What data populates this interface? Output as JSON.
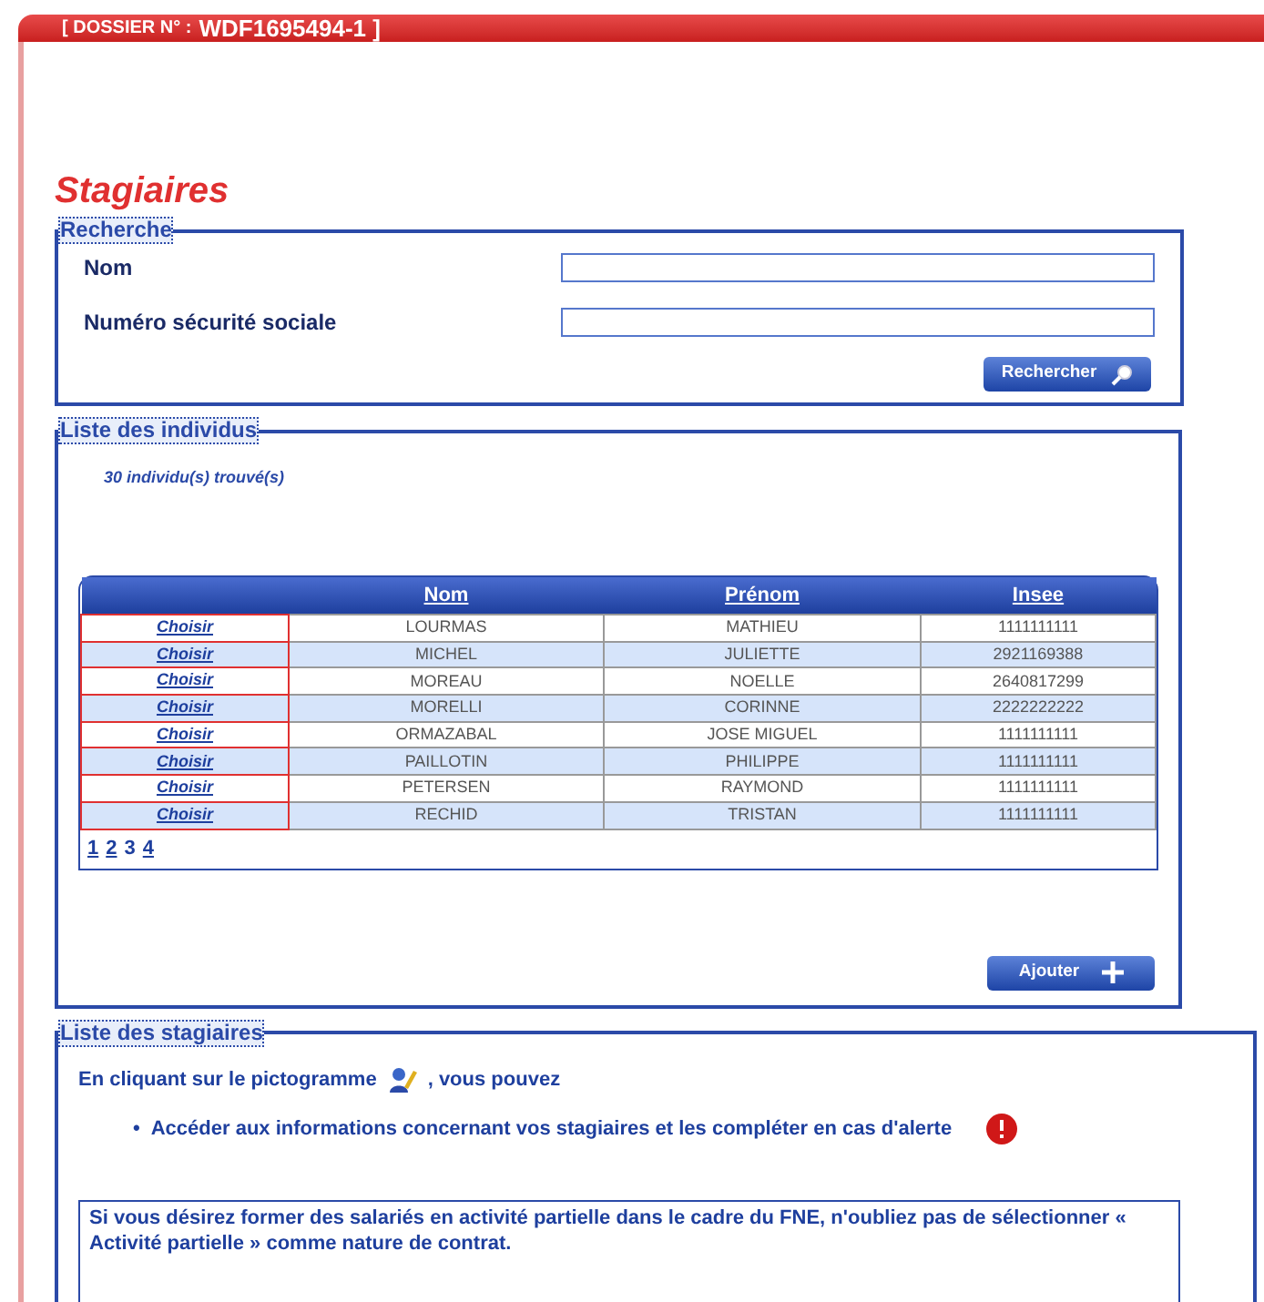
{
  "header": {
    "dossier_label": "[ DOSSIER N° :",
    "dossier_number": "WDF1695494-1 ]"
  },
  "page_title": "Stagiaires",
  "recherche": {
    "legend": "Recherche",
    "fields": [
      {
        "label": "Nom"
      },
      {
        "label": "Numéro sécurité sociale"
      }
    ],
    "button": "Rechercher"
  },
  "individus": {
    "legend": "Liste des individus",
    "count": "30 individu(s) trouvé(s)",
    "columns": [
      "",
      "Nom",
      "Prénom",
      "Insee"
    ],
    "rows": [
      {
        "action": "Choisir",
        "nom": "LOURMAS",
        "prenom": "MATHIEU",
        "insee": "1111111111"
      },
      {
        "action": "Choisir",
        "nom": "MICHEL",
        "prenom": "JULIETTE",
        "insee": "2921169388"
      },
      {
        "action": "Choisir",
        "nom": "MOREAU",
        "prenom": "NOELLE",
        "insee": "2640817299"
      },
      {
        "action": "Choisir",
        "nom": "MORELLI",
        "prenom": "CORINNE",
        "insee": "2222222222"
      },
      {
        "action": "Choisir",
        "nom": "ORMAZABAL",
        "prenom": "JOSE MIGUEL",
        "insee": "1111111111"
      },
      {
        "action": "Choisir",
        "nom": "PAILLOTIN",
        "prenom": "PHILIPPE",
        "insee": "1111111111"
      },
      {
        "action": "Choisir",
        "nom": "PETERSEN",
        "prenom": "RAYMOND",
        "insee": "1111111111"
      },
      {
        "action": "Choisir",
        "nom": "RECHID",
        "prenom": "TRISTAN",
        "insee": "1111111111"
      }
    ],
    "pages": [
      {
        "label": "1",
        "selected": false
      },
      {
        "label": "2",
        "selected": false
      },
      {
        "label": "3",
        "selected": true
      },
      {
        "label": "4",
        "selected": false
      }
    ],
    "button": "Ajouter"
  },
  "stagiaires": {
    "legend": "Liste des stagiaires",
    "intro_before": "En cliquant sur le pictogramme",
    "intro_after": ", vous pouvez",
    "bullets": [
      {
        "marker": "•",
        "text": "Accéder aux informations concernant vos stagiaires et les compléter en cas d'alerte"
      }
    ],
    "notice": [
      "Si vous désirez former des salariés en activité partielle dans le cadre du FNE, n'oubliez pas de sélectionner « Activité partielle » comme nature de contrat."
    ]
  }
}
